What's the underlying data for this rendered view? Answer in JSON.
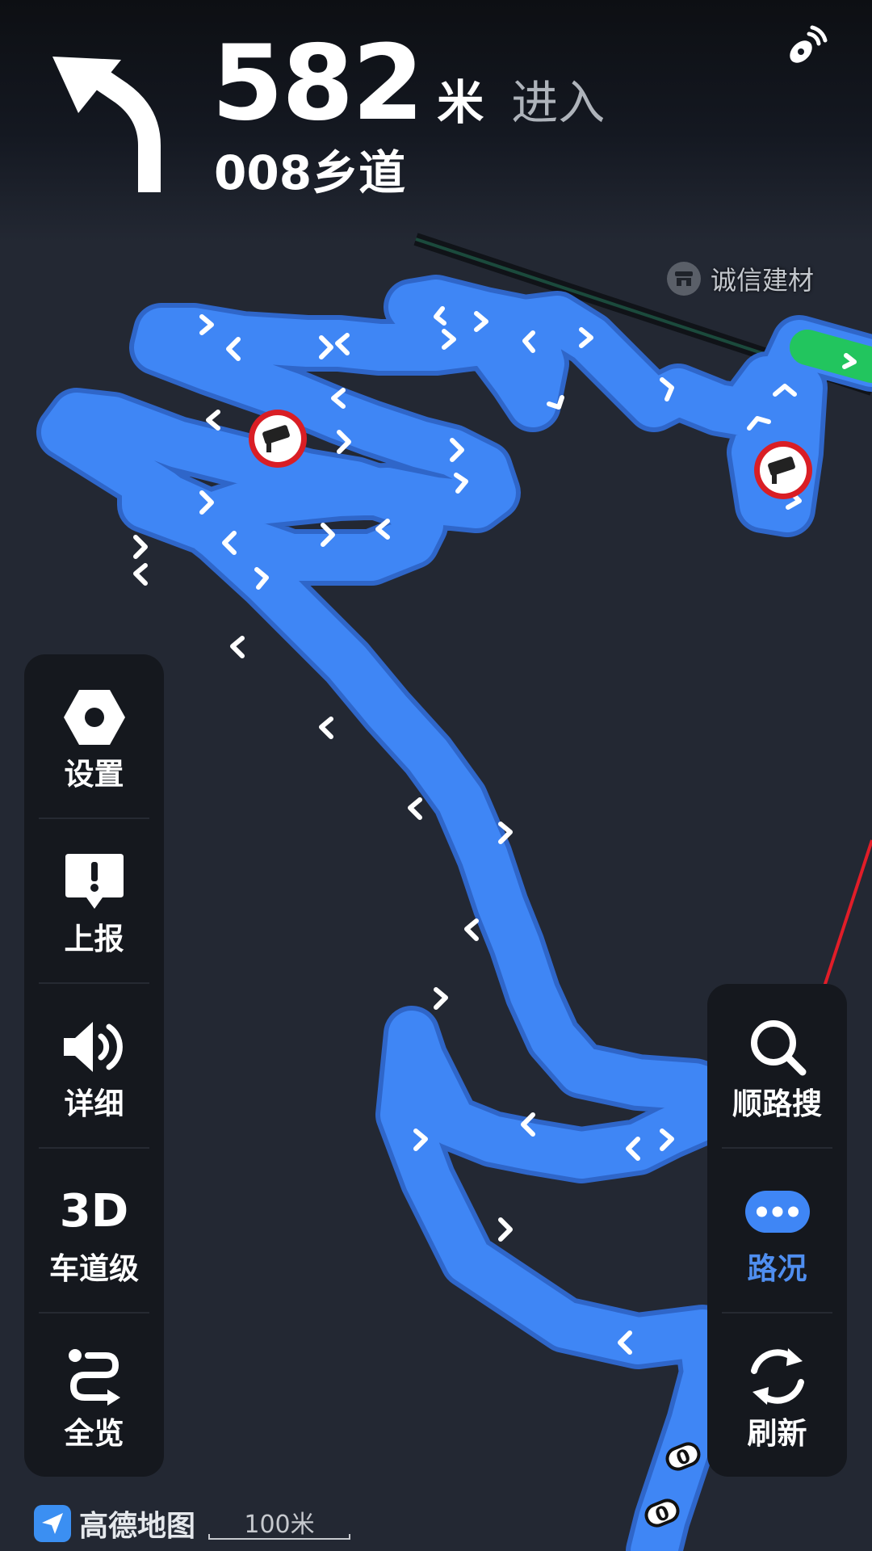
{
  "navigation": {
    "distance_value": "582",
    "distance_unit": "米",
    "action": "进入",
    "road_name": "008乡道"
  },
  "map": {
    "poi_label": "诚信建材",
    "route_color": "#3f86f5",
    "traffic_green": "#22c55e",
    "boundary_red": "#e11d28",
    "scale_label": "100米",
    "road_marker_labels": [
      "0",
      "0"
    ]
  },
  "left_panel": [
    {
      "label": "设置",
      "icon": "settings-hex-icon"
    },
    {
      "label": "上报",
      "icon": "report-icon"
    },
    {
      "label": "详细",
      "icon": "speaker-icon"
    },
    {
      "label": "车道级",
      "icon_text": "3D"
    },
    {
      "label": "全览",
      "icon": "route-overview-icon"
    }
  ],
  "right_panel": [
    {
      "label": "顺路搜",
      "icon": "search-icon",
      "active": false
    },
    {
      "label": "路况",
      "icon": "traffic-icon",
      "active": true
    },
    {
      "label": "刷新",
      "icon": "refresh-icon",
      "active": false
    }
  ],
  "brand": {
    "name": "高德地图"
  }
}
